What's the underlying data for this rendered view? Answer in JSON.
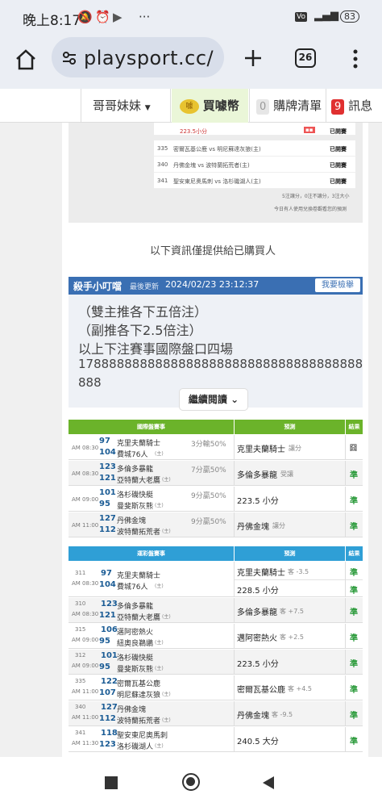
{
  "status_bar": {
    "time": "晚上8:17",
    "battery": "83",
    "icons": [
      "mute-icon",
      "alarm-icon",
      "youtube-icon",
      "more-icon",
      "volte-icon",
      "signal-icon",
      "battery-icon"
    ]
  },
  "browser": {
    "url": "playsport.cc/",
    "tab_count": "26"
  },
  "site_nav": {
    "menu_label": "哥哥妹妹",
    "coin_label": "買噱幣",
    "cart_count": "0",
    "cart_label": "購牌清單",
    "msg_count": "9",
    "msg_label": "訊息"
  },
  "top_table": {
    "rows": [
      {
        "num": "",
        "teams": "223.5小分",
        "status": "已開賽"
      },
      {
        "num": "335",
        "teams": "密爾瓦基公鹿 vs 明尼蘇達灰狼(主)",
        "status": "已開賽"
      },
      {
        "num": "340",
        "teams": "丹佛金塊 vs 波特蘭拓荒者(主)",
        "status": "已開賽"
      },
      {
        "num": "341",
        "teams": "聖安東尼奧馬刺 vs 洛杉磯湖人(主)",
        "status": "已開賽"
      }
    ],
    "note1": "5注讓分，0注不讓分，3注大小",
    "note2": "今日有人使用兌換卷觀看您的預測"
  },
  "info_notice": "以下資訊僅提供給已購買人",
  "killer": {
    "name": "殺手小叮噹",
    "updated_label": "最後更新",
    "updated": "2024/02/23 23:12:37",
    "check_btn": "我要檢舉",
    "lines": [
      "（雙主推各下五倍注）",
      "（副推各下2.5倍注）",
      "以上下注賽事國際盤口四場",
      "1788888888888888888888888888888888888888",
      "888"
    ],
    "read_more": "繼續閱讀"
  },
  "intl_table": {
    "header": {
      "game": "國際盤賽事",
      "pred": "預測",
      "result": "結果"
    },
    "rows": [
      {
        "time": "AM 08:30",
        "n1": "97",
        "t1": "克里夫蘭騎士",
        "n2": "104",
        "t2": "費城76人",
        "t2s": "(主)",
        "score": "3分輸50%",
        "pick": "克里夫蘭騎士",
        "pickSub": "讓分",
        "res": "囧"
      },
      {
        "time": "AM 08:30",
        "n1": "123",
        "t1": "多倫多暴龍",
        "n2": "121",
        "t2": "亞特蘭大老鷹",
        "t2s": "(主)",
        "score": "7分贏50%",
        "pick": "多倫多暴龍",
        "pickSub": "受讓",
        "res": "準"
      },
      {
        "time": "AM 09:00",
        "n1": "101",
        "t1": "洛杉磯快艇",
        "n2": "95",
        "t2": "曼斐斯灰熊",
        "t2s": "(主)",
        "score": "9分贏50%",
        "pick": "223.5 小分",
        "pickSub": "",
        "res": "準"
      },
      {
        "time": "AM 11:00",
        "n1": "127",
        "t1": "丹佛金塊",
        "n2": "112",
        "t2": "波特蘭拓荒者",
        "t2s": "(主)",
        "score": "9分贏50%",
        "pick": "丹佛金塊",
        "pickSub": "讓分",
        "res": "準"
      }
    ]
  },
  "sports_table": {
    "header": {
      "game": "運彩盤賽事",
      "pred": "預測",
      "result": "結果"
    },
    "rows": [
      {
        "id": "311",
        "time": "AM 08:30",
        "n1": "97",
        "t1": "克里夫蘭騎士",
        "n2": "104",
        "t2": "費城76人",
        "t2s": "(主)",
        "picks": [
          {
            "p": "克里夫蘭騎士",
            "o": "客 -3.5",
            "r": "準"
          },
          {
            "p": "228.5 小分",
            "o": "",
            "r": "準"
          }
        ]
      },
      {
        "id": "310",
        "time": "AM 08:30",
        "n1": "123",
        "t1": "多倫多暴龍",
        "n2": "121",
        "t2": "亞特蘭大老鷹",
        "t2s": "(主)",
        "picks": [
          {
            "p": "多倫多暴龍",
            "o": "客 +7.5",
            "r": "準"
          }
        ]
      },
      {
        "id": "315",
        "time": "AM 09:00",
        "n1": "106",
        "t1": "邁阿密熱火",
        "n2": "95",
        "t2": "紐奧良鵜鶘",
        "t2s": "(主)",
        "picks": [
          {
            "p": "邁阿密熱火",
            "o": "客 +2.5",
            "r": "準"
          }
        ]
      },
      {
        "id": "312",
        "time": "AM 09:00",
        "n1": "101",
        "t1": "洛杉磯快艇",
        "n2": "95",
        "t2": "曼斐斯灰熊",
        "t2s": "(主)",
        "picks": [
          {
            "p": "223.5 小分",
            "o": "",
            "r": "準"
          }
        ]
      },
      {
        "id": "335",
        "time": "AM 11:00",
        "n1": "122",
        "t1": "密爾瓦基公鹿",
        "n2": "107",
        "t2": "明尼蘇達灰狼",
        "t2s": "(主)",
        "picks": [
          {
            "p": "密爾瓦基公鹿",
            "o": "客 +4.5",
            "r": "準"
          }
        ]
      },
      {
        "id": "340",
        "time": "AM 11:00",
        "n1": "127",
        "t1": "丹佛金塊",
        "n2": "112",
        "t2": "波特蘭拓荒者",
        "t2s": "(主)",
        "picks": [
          {
            "p": "丹佛金塊",
            "o": "客 -9.5",
            "r": "準"
          }
        ]
      },
      {
        "id": "341",
        "time": "AM 11:30",
        "n1": "118",
        "t1": "聖安東尼奧馬刺",
        "n2": "123",
        "t2": "洛杉磯湖人",
        "t2s": "(主)",
        "picks": [
          {
            "p": "240.5 大分",
            "o": "",
            "r": "準"
          }
        ]
      }
    ]
  }
}
